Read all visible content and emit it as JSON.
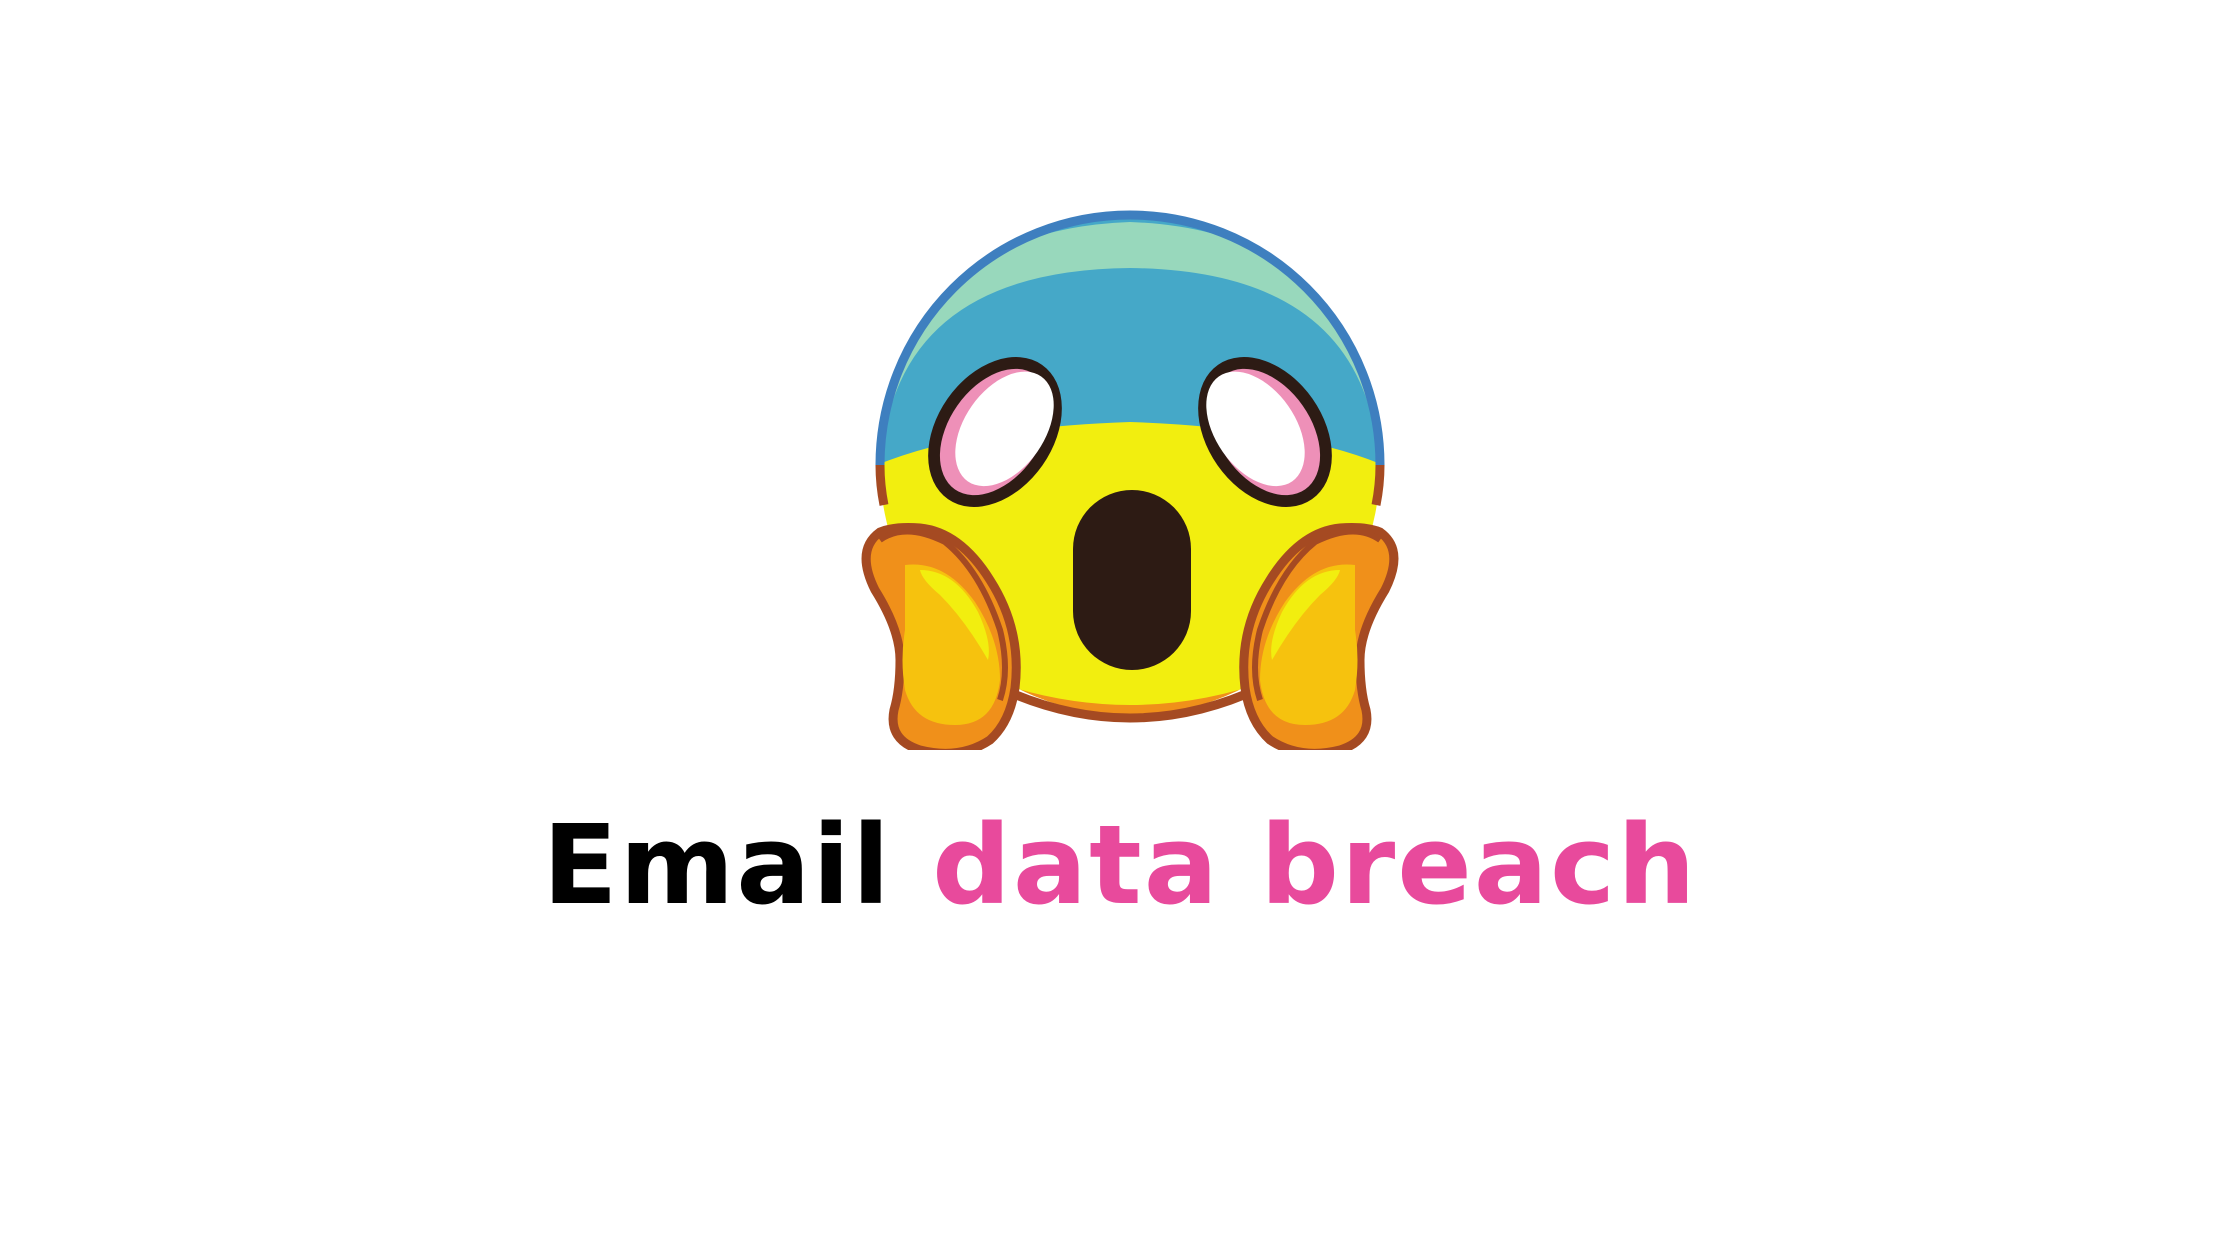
{
  "headline": {
    "part_1": "Email",
    "part_2": "data breach"
  },
  "icons": {
    "main": "face-screaming-in-fear-icon"
  },
  "colors": {
    "background": "#ffffff",
    "text_primary": "#000000",
    "text_accent": "#e84a9c",
    "face_yellow": "#f2ee0f",
    "face_blue": "#45a8c8",
    "face_outline_blue": "#3e7fbf",
    "face_highlight": "#98d8bc",
    "hand_orange": "#f0901a",
    "outline_brown": "#a54a22",
    "eye_outline": "#2d1b14",
    "eye_pink": "#ee90b8"
  }
}
